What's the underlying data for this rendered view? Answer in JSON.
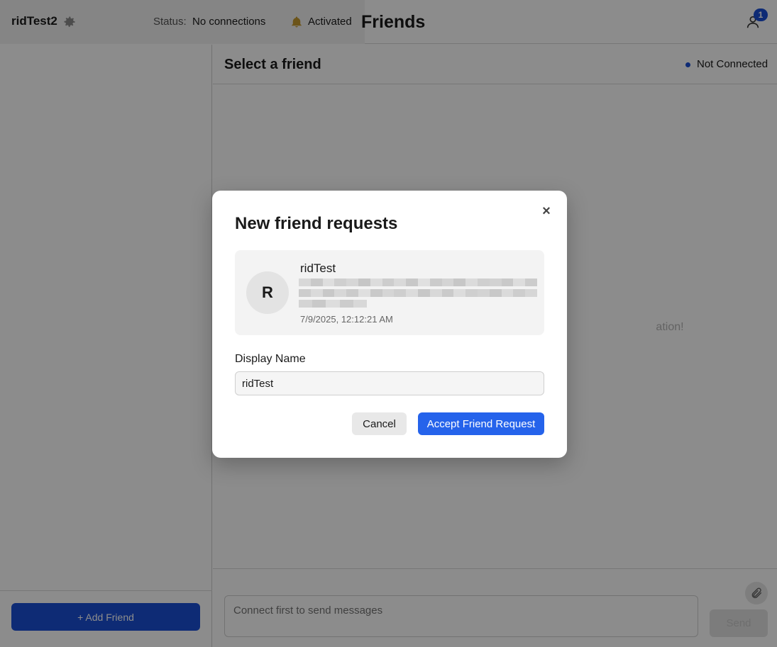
{
  "header": {
    "username": "ridTest2",
    "status_label": "Status:",
    "status_value": "No connections",
    "notifications_label": "Activated",
    "title": "Friends",
    "request_badge_count": "1",
    "icons": {
      "settings": "gear-icon",
      "notifications": "bell-icon",
      "friend_requests": "user-icon"
    }
  },
  "sidebar": {
    "add_friend_label": "+ Add Friend"
  },
  "chat": {
    "title": "Select a friend",
    "connection_status": "Not Connected",
    "empty_hint_visible": "ation!",
    "input_placeholder": "Connect first to send messages",
    "send_label": "Send",
    "icons": {
      "attach": "paperclip-icon"
    }
  },
  "modal": {
    "title": "New friend requests",
    "close_label": "×",
    "request": {
      "avatar_initial": "R",
      "name": "ridTest",
      "timestamp": "7/9/2025, 12:12:21 AM"
    },
    "display_name_label": "Display Name",
    "display_name_value": "ridTest",
    "cancel_label": "Cancel",
    "accept_label": "Accept Friend Request"
  },
  "colors": {
    "primary": "#2563eb",
    "dark_primary": "#1a4fd6",
    "overlay": "rgba(0,0,0,0.45)"
  }
}
